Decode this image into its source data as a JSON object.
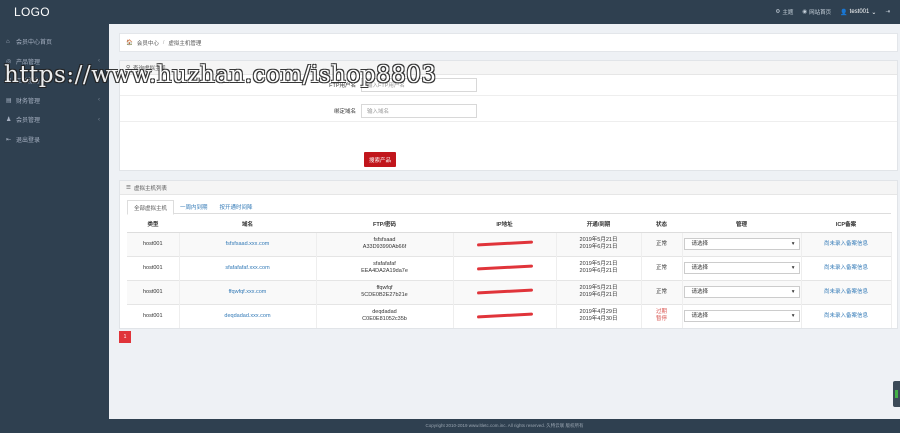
{
  "header": {
    "logo": "LOGO",
    "nav": [
      {
        "icon": "gear-icon",
        "label": "主题"
      },
      {
        "icon": "globe-icon",
        "label": "网站首页"
      }
    ],
    "user": "test001",
    "logout_icon": "logout-icon"
  },
  "sidebar": {
    "items": [
      {
        "icon": "home-icon",
        "label": "会员中心首页",
        "arrow": false
      },
      {
        "icon": "box-icon",
        "label": "产品管理",
        "arrow": true
      },
      {
        "icon": "ticket-icon",
        "label": "工单服务",
        "arrow": true
      },
      {
        "icon": "wallet-icon",
        "label": "财务管理",
        "arrow": true
      },
      {
        "icon": "user-icon",
        "label": "会员管理",
        "arrow": true
      },
      {
        "icon": "exit-icon",
        "label": "退出登录",
        "arrow": false
      }
    ]
  },
  "breadcrumb": {
    "home": "会员中心",
    "separator": "/",
    "current": "虚拟主机管理"
  },
  "search_panel": {
    "title": "查询虚拟主机",
    "ftp_label": "FTP用户名",
    "ftp_placeholder": "输入FTP用户名",
    "domain_label": "绑定域名",
    "domain_placeholder": "输入域名",
    "button": "搜索产品"
  },
  "list_panel": {
    "title": "虚拟主机列表",
    "tabs": [
      "全部虚拟主机",
      "一周内到期",
      "按开通时间降"
    ],
    "columns": [
      "类型",
      "域名",
      "FTP/密码",
      "IP地址",
      "开通/到期",
      "状态",
      "管理",
      "ICP备案"
    ],
    "rows": [
      {
        "type": "host001",
        "domain": "fsfsfsaad.xxx.com",
        "ftp_user": "fsfsfsaad",
        "ftp_pass": "A33D93990Ab66f",
        "open": "2019年5月21日",
        "expire": "2019年6月21日",
        "status": "正常",
        "status_line2": "",
        "manage": "请选择",
        "icp": "尚未录入备案信息"
      },
      {
        "type": "host001",
        "domain": "sfafafafaf.xxx.com",
        "ftp_user": "sfafafafaf",
        "ftp_pass": "EEA4DA2A19da7e",
        "open": "2019年5月21日",
        "expire": "2019年6月21日",
        "status": "正常",
        "status_line2": "",
        "manage": "请选择",
        "icp": "尚未录入备案信息"
      },
      {
        "type": "host001",
        "domain": "ffqwfqf.xxx.com",
        "ftp_user": "ffqwfqf",
        "ftp_pass": "5CDE0B2E27b21e",
        "open": "2019年5月21日",
        "expire": "2019年6月21日",
        "status": "正常",
        "status_line2": "",
        "manage": "请选择",
        "icp": "尚未录入备案信息"
      },
      {
        "type": "host001",
        "domain": "deqdadad.xxx.com",
        "ftp_user": "deqdadad",
        "ftp_pass": "C0E0E81052c35b",
        "open": "2019年4月29日",
        "expire": "2019年4月30日",
        "status": "过期",
        "status_line2": "暂停",
        "manage": "请选择",
        "icp": "尚未录入备案信息"
      }
    ]
  },
  "pagination": {
    "current": "1"
  },
  "footer": {
    "copyright": "Copyright 2010-2019 www.ltletc.com.inc. All rights reserved. 久特云联 版权所有"
  },
  "watermark": "https://www.huzhan.com/ishop8803",
  "colors": {
    "sidebar": "#2f4050",
    "primary_red": "#c1161c",
    "link": "#337ab7"
  }
}
